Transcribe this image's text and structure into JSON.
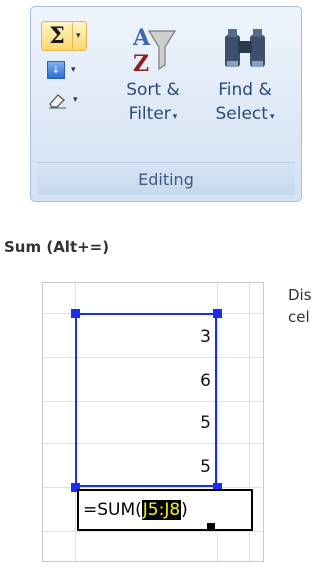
{
  "editing_group": {
    "label": "Editing",
    "autosum_symbol": "Σ",
    "dropdown_glyph": "▾",
    "sort_filter": {
      "line1": "Sort &",
      "line2": "Filter"
    },
    "find_select": {
      "line1": "Find &",
      "line2": "Select"
    }
  },
  "tooltip": {
    "title": "Sum (Alt+=)",
    "description_lines": [
      "Dis",
      "cel"
    ],
    "cells": [
      "3",
      "6",
      "5",
      "5"
    ],
    "formula_prefix": "=SUM(",
    "formula_range": "J5:J8",
    "formula_suffix": ")"
  },
  "colors": {
    "selection": "#1b2ef0",
    "range_highlight_text": "#f4f21a",
    "group_label": "#3c5a82"
  }
}
